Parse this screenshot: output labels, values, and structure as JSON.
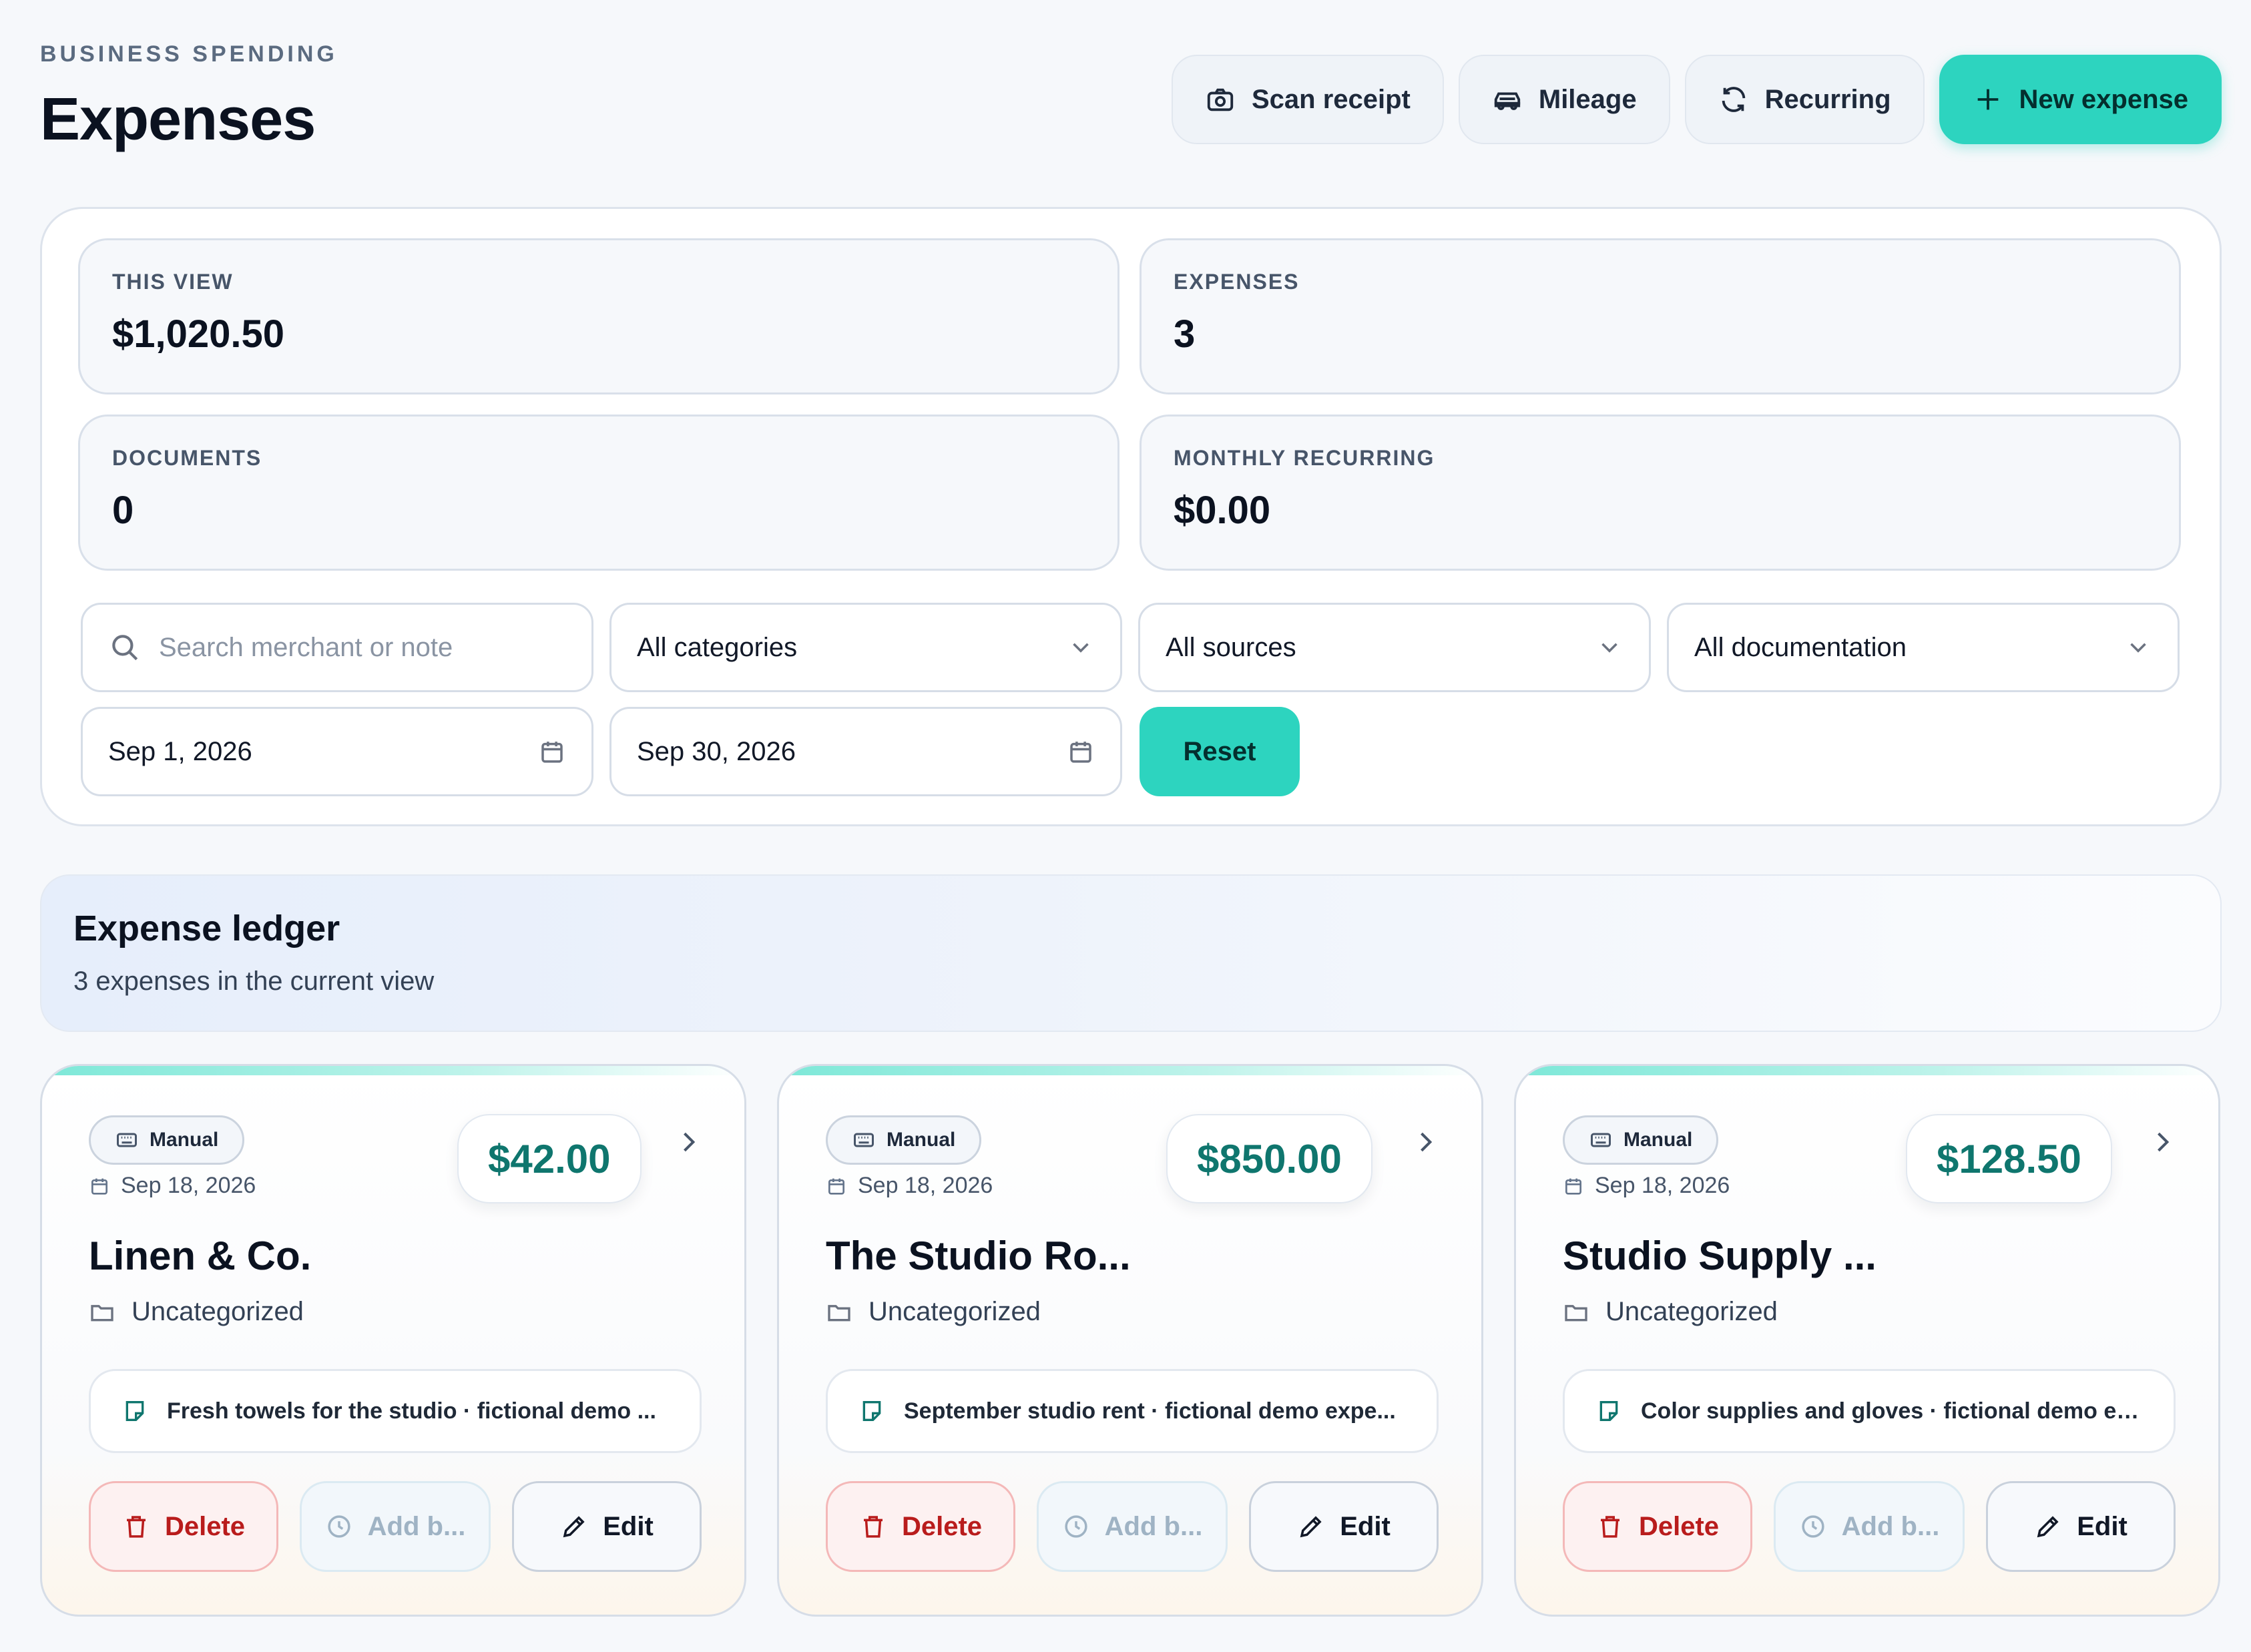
{
  "header": {
    "eyebrow": "BUSINESS SPENDING",
    "title": "Expenses",
    "actions": {
      "scan_receipt": "Scan receipt",
      "mileage": "Mileage",
      "recurring": "Recurring",
      "new_expense": "New expense"
    }
  },
  "summary": {
    "this_view": {
      "label": "THIS VIEW",
      "value": "$1,020.50"
    },
    "expenses": {
      "label": "EXPENSES",
      "value": "3"
    },
    "documents": {
      "label": "DOCUMENTS",
      "value": "0"
    },
    "monthly_recurring": {
      "label": "MONTHLY RECURRING",
      "value": "$0.00"
    }
  },
  "filters": {
    "search_placeholder": "Search merchant or note",
    "category": "All categories",
    "source": "All sources",
    "documentation": "All documentation",
    "date_from": "Sep 1, 2026",
    "date_to": "Sep 30, 2026",
    "reset_label": "Reset"
  },
  "ledger": {
    "title": "Expense ledger",
    "subtitle": "3 expenses in the current view"
  },
  "cards": [
    {
      "source": "Manual",
      "date": "Sep 18, 2026",
      "amount": "$42.00",
      "merchant": "Linen & Co.",
      "category": "Uncategorized",
      "note": "Fresh towels for the studio · fictional demo ...",
      "delete_label": "Delete",
      "add_label": "Add b...",
      "edit_label": "Edit"
    },
    {
      "source": "Manual",
      "date": "Sep 18, 2026",
      "amount": "$850.00",
      "merchant": "The Studio Ro...",
      "category": "Uncategorized",
      "note": "September studio rent · fictional demo expe...",
      "delete_label": "Delete",
      "add_label": "Add b...",
      "edit_label": "Edit"
    },
    {
      "source": "Manual",
      "date": "Sep 18, 2026",
      "amount": "$128.50",
      "merchant": "Studio Supply ...",
      "category": "Uncategorized",
      "note": "Color supplies and gloves · fictional demo ex...",
      "delete_label": "Delete",
      "add_label": "Add b...",
      "edit_label": "Edit"
    }
  ],
  "colors": {
    "accent": "#2dd4bf",
    "amount": "#0f766e",
    "danger": "#b91c1c"
  },
  "icons": [
    "camera-icon",
    "car-icon",
    "refresh-icon",
    "plus-icon",
    "search-icon",
    "chevron-down-icon",
    "calendar-icon",
    "keyboard-icon",
    "folder-icon",
    "note-icon",
    "trash-icon",
    "clock-icon",
    "pencil-icon",
    "chevron-right-icon"
  ]
}
